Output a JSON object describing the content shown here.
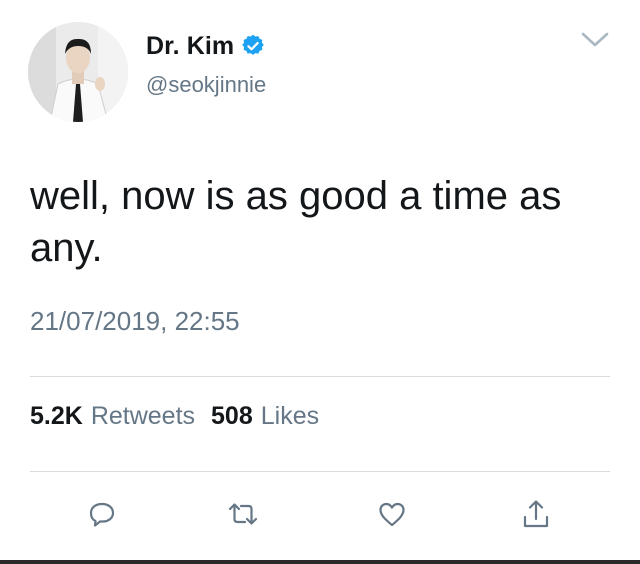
{
  "tweet": {
    "author": {
      "display_name": "Dr. Kim",
      "handle": "@seokjinnie",
      "verified": true,
      "avatar": "profile-photo"
    },
    "text": "well, now is as good a time as any.",
    "timestamp": "21/07/2019, 22:55",
    "stats": {
      "retweets_count": "5.2K",
      "retweets_label": "Retweets",
      "likes_count": "508",
      "likes_label": "Likes"
    },
    "actions": [
      "reply-icon",
      "retweet-icon",
      "heart-icon",
      "share-icon"
    ]
  },
  "colors": {
    "text_primary": "#14171a",
    "text_secondary": "#657786",
    "verified_blue": "#1da1f2",
    "divider": "#d7dce0",
    "icon": "#657786"
  }
}
